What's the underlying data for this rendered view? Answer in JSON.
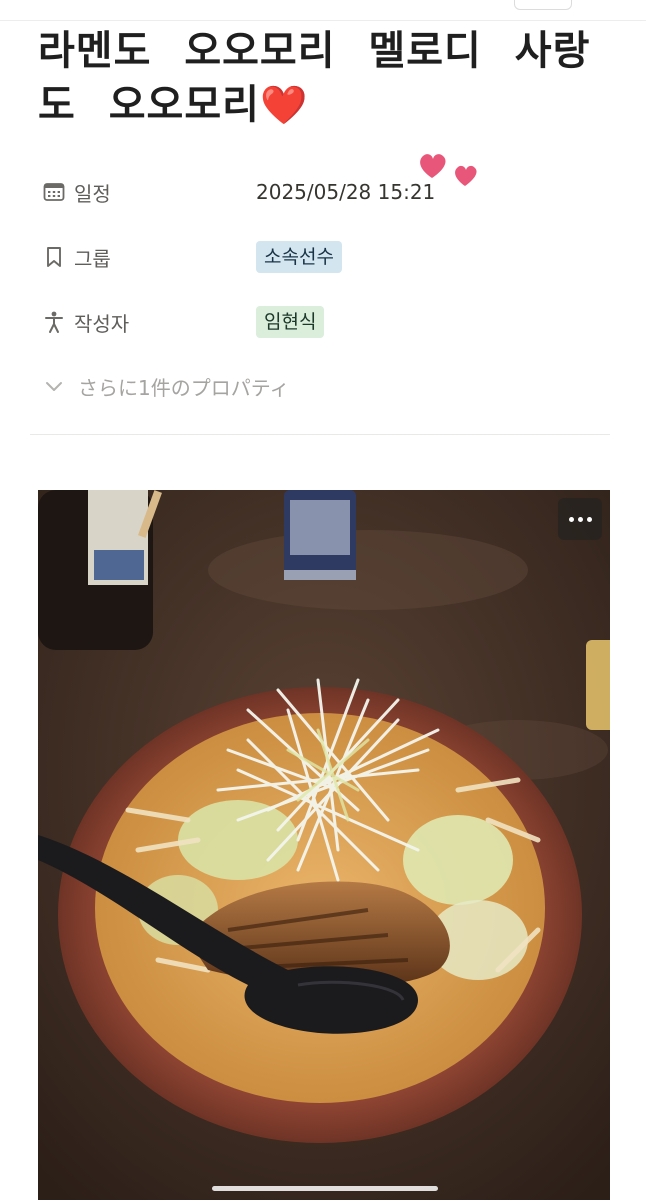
{
  "page": {
    "title": "라멘도 오오모리 멜로디 사랑도 오오모리",
    "title_emoji": "❤️"
  },
  "properties": [
    {
      "icon": "calendar-icon",
      "label": "일정",
      "value": "2025/05/28 15:21",
      "type": "text"
    },
    {
      "icon": "bookmark-icon",
      "label": "그룹",
      "value": "소속선수",
      "type": "tag",
      "tag_color": "#d3e5ef"
    },
    {
      "icon": "person-icon",
      "label": "작성자",
      "value": "임현식",
      "type": "tag",
      "tag_color": "#dbeddb"
    }
  ],
  "more_properties": {
    "icon": "chevron-down-icon",
    "label": "さらに1件のプロパティ"
  },
  "image": {
    "description_icon": "ramen-photo",
    "menu_icon": "more-horizontal-icon"
  },
  "colors": {
    "heart": "#e0101b",
    "decor_heart": "#e8577a",
    "tag_blue": "#d3e5ef",
    "tag_green": "#dbeddb",
    "label_gray": "#5f5e5b",
    "muted_gray": "#a5a4a1"
  }
}
